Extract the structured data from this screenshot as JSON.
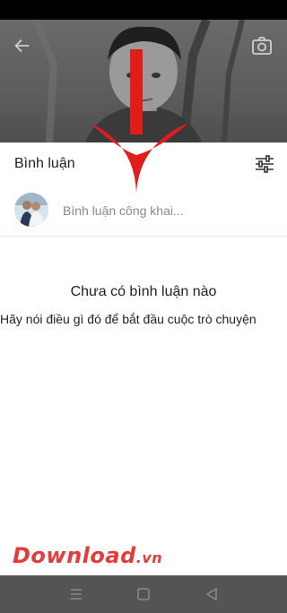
{
  "comments": {
    "title": "Bình luận",
    "input_placeholder": "Bình luận công khai...",
    "empty_title": "Chưa có bình luận nào",
    "empty_subtitle": "Hãy nói điều gì đó để bắt đầu cuộc trò chuyện"
  },
  "icons": {
    "back": "arrow-left",
    "camera": "camera",
    "filter": "sliders",
    "nav": [
      "menu",
      "home-square",
      "back-triangle"
    ]
  },
  "watermark": {
    "main": "Download",
    "tld": ".vn"
  },
  "colors": {
    "accent_red": "#e21b1b",
    "watermark_red": "#e43b3b"
  }
}
